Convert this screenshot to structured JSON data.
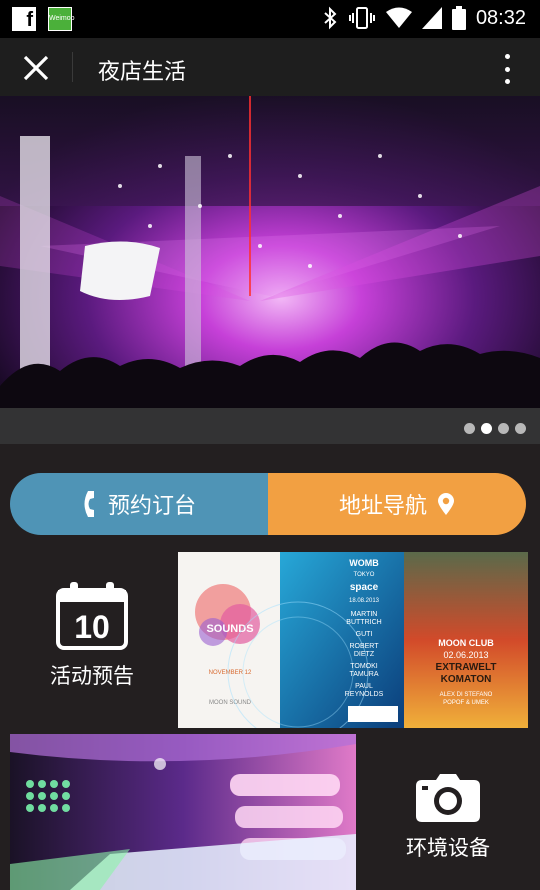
{
  "status_bar": {
    "time": "08:32",
    "left_icons": [
      "facebook-icon",
      "weimob-icon"
    ],
    "weimob_text": "Weimob",
    "right_icons": [
      "bluetooth-icon",
      "vibrate-icon",
      "wifi-icon",
      "signal-icon",
      "battery-icon"
    ]
  },
  "app_bar": {
    "title": "夜店生活",
    "left_icon": "close-icon",
    "right_icon": "more-vertical-icon"
  },
  "banner": {
    "slide_count": 4,
    "active_slide": 2
  },
  "actions": {
    "book_label": "预约订台",
    "book_icon": "phone-icon",
    "book_color": "#4f94b6",
    "nav_label": "地址导航",
    "nav_icon": "location-pin-icon",
    "nav_color": "#f2a042"
  },
  "tiles": {
    "events_label": "活动预告",
    "events_icon": "calendar-icon",
    "events_icon_number": "10",
    "environment_label": "环境设备",
    "environment_icon": "camera-icon"
  },
  "posters": {
    "poster1": {
      "title": "SOUNDS",
      "date": "NOVEMBER 12",
      "footer": "MOON SOUND"
    },
    "poster2": {
      "title": "WOMB",
      "subtitle": "TOKYO",
      "brand": "space",
      "date": "18.08.2013",
      "lineup": [
        "MARTIN",
        "BUTTRICH",
        "GUTI",
        "ROBERT",
        "DIETZ",
        "TOMOKI",
        "TAMURA",
        "PAUL",
        "REYNOLDS"
      ]
    },
    "poster3": {
      "title": "MOON CLUB",
      "date": "02.06.2013",
      "headline1": "EXTRAWELT",
      "headline2": "KOMATON",
      "act": "ALEX DI STEFANO",
      "act2": "POPOF & UMEK"
    }
  },
  "colors": {
    "background": "#231f20",
    "status_bar": "#000000",
    "app_bar": "#1e1e1e"
  }
}
